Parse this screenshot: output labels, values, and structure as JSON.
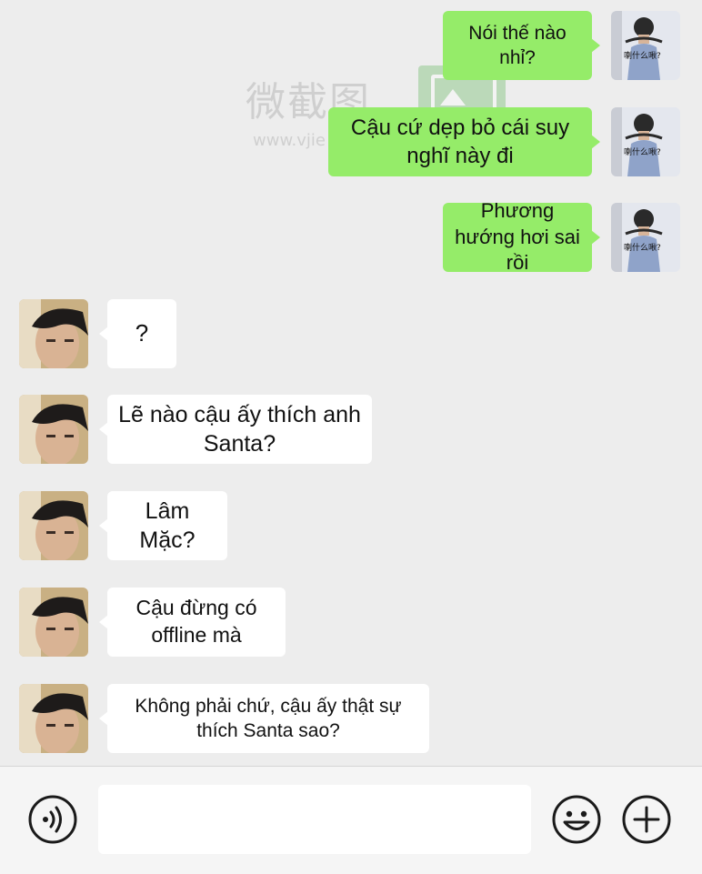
{
  "watermark": {
    "text": "微截图",
    "url": "www.vjie"
  },
  "colors": {
    "outgoing_bubble": "#95ec69",
    "incoming_bubble": "#ffffff",
    "background": "#ededed"
  },
  "messages": [
    {
      "side": "out",
      "text": "Nói thế nào nhỉ?",
      "avatar_caption": "喇什么啾?"
    },
    {
      "side": "out",
      "text": "Cậu cứ dẹp bỏ cái suy nghĩ này đi",
      "avatar_caption": "喇什么啾?"
    },
    {
      "side": "out",
      "text": "Phương hướng hơi sai rồi",
      "avatar_caption": "喇什么啾?"
    },
    {
      "side": "in",
      "text": "?"
    },
    {
      "side": "in",
      "text": "Lẽ nào cậu ấy thích anh Santa?"
    },
    {
      "side": "in",
      "text": "Lâm Mặc?"
    },
    {
      "side": "in",
      "text": "Cậu đừng có offline mà"
    },
    {
      "side": "in",
      "text": "Không phải chứ, cậu ấy thật sự thích Santa sao?"
    }
  ],
  "toolbar": {
    "voice_icon": "voice-icon",
    "emoji_icon": "emoji-icon",
    "plus_icon": "plus-icon",
    "input_value": ""
  }
}
